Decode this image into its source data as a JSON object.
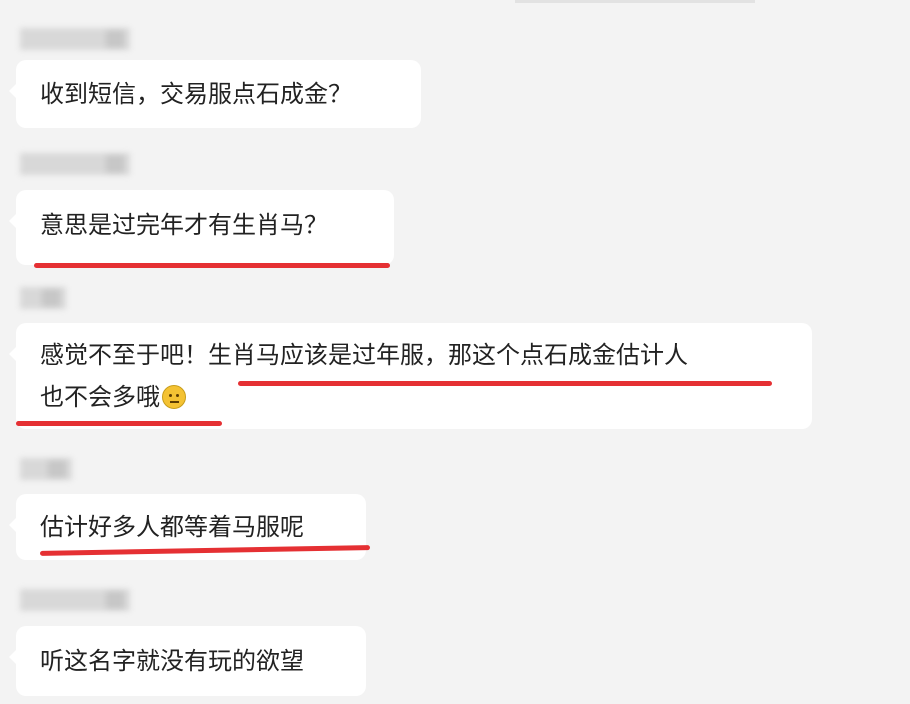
{
  "messages": [
    {
      "text": "收到短信，交易服点石成金？"
    },
    {
      "text": "意思是过完年才有生肖马？"
    },
    {
      "text_line1": "感觉不至于吧！生肖马应该是过年服，那这个点石成金估计人",
      "text_line2": "也不会多哦"
    },
    {
      "text": "估计好多人都等着马服呢"
    },
    {
      "text": "听这名字就没有玩的欲望"
    }
  ],
  "emoji": "neutral-face-emoji",
  "annotation_color": "#e53033"
}
